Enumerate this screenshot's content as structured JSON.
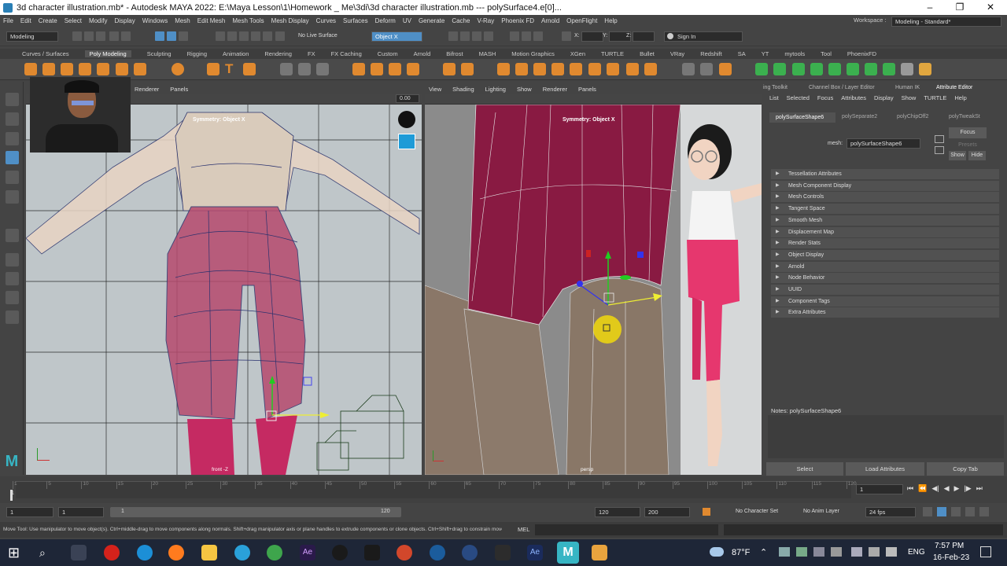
{
  "window": {
    "title": "3d character illustration.mb* - Autodesk MAYA 2022: E:\\Maya Lesson\\1\\Homework _ Me\\3di\\3d character illustration.mb   ---   polySurface4.e[0]...",
    "minimize": "–",
    "maximize": "❐",
    "close": "✕"
  },
  "menubar": [
    "File",
    "Edit",
    "Create",
    "Select",
    "Modify",
    "Display",
    "Windows",
    "Mesh",
    "Edit Mesh",
    "Mesh Tools",
    "Mesh Display",
    "Curves",
    "Surfaces",
    "Deform",
    "UV",
    "Generate",
    "Cache",
    "V-Ray",
    "Phoenix FD",
    "Arnold",
    "OpenFlight",
    "Help"
  ],
  "workspace": {
    "label": "Workspace :",
    "value": "Modeling - Standard*"
  },
  "statusline": {
    "mode": "Modeling",
    "live_surface": "No Live Surface",
    "symmetry": "Object X",
    "x_label": "X:",
    "y_label": "Y:",
    "z_label": "Z:",
    "sign_in": "Sign In"
  },
  "shelf_tabs": [
    "Curves / Surfaces",
    "Poly Modeling",
    "Sculpting",
    "Rigging",
    "Animation",
    "Rendering",
    "FX",
    "FX Caching",
    "Custom",
    "Arnold",
    "Bifrost",
    "MASH",
    "Motion Graphics",
    "XGen",
    "TURTLE",
    "Bullet",
    "VRay",
    "Redshift",
    "SA",
    "YT",
    "mytools",
    "Tool",
    "PhoenixFD"
  ],
  "shelf_active": "Poly Modeling",
  "viewport_left": {
    "menus": [
      "Renderer",
      "Panels"
    ],
    "symmetry": "Symmetry: Object X",
    "camera": "front -Z",
    "field_value": "0.00"
  },
  "viewport_right": {
    "menus": [
      "View",
      "Shading",
      "Lighting",
      "Show",
      "Renderer",
      "Panels"
    ],
    "symmetry": "Symmetry: Object X",
    "camera": "persp"
  },
  "right_panel": {
    "tabs": [
      "ing Toolkit",
      "Channel Box / Layer Editor",
      "Human IK",
      "Attribute Editor"
    ],
    "menu": [
      "List",
      "Selected",
      "Focus",
      "Attributes",
      "Display",
      "Show",
      "TURTLE",
      "Help"
    ],
    "node_tabs": [
      "polySurfaceShape6",
      "polySeparate2",
      "polyChipOff2",
      "polyTweakSt"
    ],
    "mesh_label": "mesh:",
    "mesh_value": "polySurfaceShape6",
    "focus": "Focus",
    "presets": "Presets",
    "show": "Show",
    "hide": "Hide",
    "sections": [
      "Tessellation Attributes",
      "Mesh Component Display",
      "Mesh Controls",
      "Tangent Space",
      "Smooth Mesh",
      "Displacement Map",
      "Render Stats",
      "Object Display",
      "Arnold",
      "Node Behavior",
      "UUID",
      "Component Tags",
      "Extra Attributes"
    ],
    "notes": "Notes:  polySurfaceShape6",
    "buttons": [
      "Select",
      "Load Attributes",
      "Copy Tab"
    ]
  },
  "timeline": {
    "ticks": [
      "1",
      "5",
      "10",
      "15",
      "20",
      "25",
      "30",
      "35",
      "40",
      "45",
      "50",
      "55",
      "60",
      "65",
      "70",
      "75",
      "80",
      "85",
      "90",
      "95",
      "100",
      "105",
      "110",
      "115",
      "120"
    ],
    "current_frame": "1"
  },
  "range": {
    "start": "1",
    "start2": "1",
    "start_label": "1",
    "end_label": "120",
    "end": "120",
    "end2": "200",
    "character_set": "No Character Set",
    "anim_layer": "No Anim Layer",
    "fps": "24 fps"
  },
  "command": {
    "help": "Move Tool: Use manipulator to move object(s). Ctrl+middle-drag to move components along normals. Shift+drag manipulator axis or plane handles to extrude components or clone objects. Ctrl+Shift+drag to constrain movement to a connected edge.",
    "lang": "MEL"
  },
  "taskbar": {
    "weather": "87°F",
    "lang": "ENG",
    "time": "7:57 PM",
    "date": "16-Feb-23"
  },
  "colors": {
    "accent_blue": "#4f8fc6",
    "maroon": "#8a1a3e",
    "pink": "#e8376f"
  }
}
